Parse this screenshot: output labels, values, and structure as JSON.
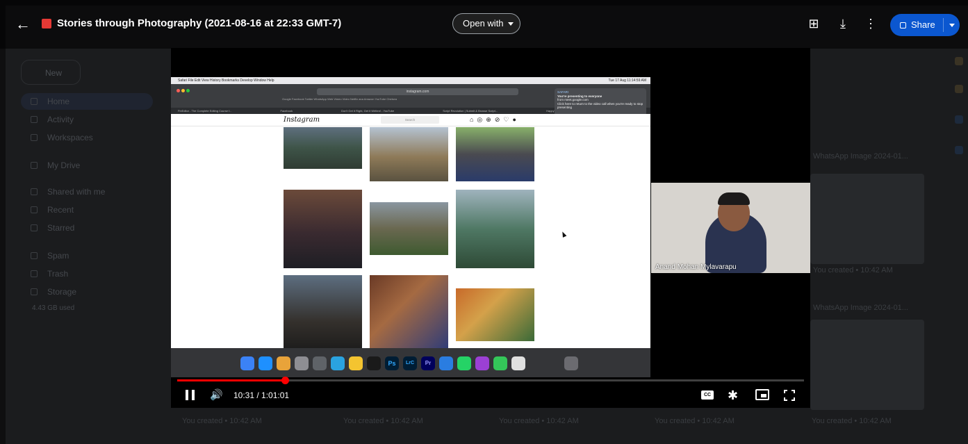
{
  "header": {
    "title": "Stories through Photography (2021-08-16 at 22:33 GMT-7)",
    "open_with_label": "Open with",
    "share_label": "Share"
  },
  "drive_sidebar": {
    "new_label": "New",
    "items": [
      {
        "label": "Home"
      },
      {
        "label": "Activity"
      },
      {
        "label": "Workspaces"
      },
      {
        "label": "My Drive"
      },
      {
        "label": "Shared with me"
      },
      {
        "label": "Recent"
      },
      {
        "label": "Starred"
      },
      {
        "label": "Spam"
      },
      {
        "label": "Trash"
      },
      {
        "label": "Storage"
      }
    ],
    "storage_used": "4.43 GB used"
  },
  "drive_files": {
    "card1_title": "WhatsApp Image 2024-01...",
    "card1_meta": "You created • 10:42 AM",
    "card2_title": "WhatsApp Image 2024-01...",
    "bottom_meta": [
      "You created • 10:42 AM",
      "You created • 10:42 AM",
      "You created • 10:42 AM",
      "You created • 10:42 AM",
      "You created • 10:42 AM"
    ]
  },
  "shared_screen": {
    "menubar": "Safari   File   Edit   View   History   Bookmarks   Develop   Window   Help",
    "clock": "Tue 17 Aug  11:14:59 AM",
    "url": "instagram.com",
    "favorites": "Google   Facebook   Twitter   WhatsApp Web   Vimeo Video   Netflix   ana   Amazon   YouTube   Chelsea",
    "tabs": [
      "FinEditor - The Complete Editing Course f...",
      "Facebook",
      "Don't Get it Right, Get it Written! - YouTube",
      "Script Revolution | Submit & Browse Script...",
      "Happy's Photography (@happys_ph..."
    ],
    "notification_app": "SAFARI",
    "notification_title": "You're presenting to everyone",
    "notification_body": "from meet.google.com",
    "notification_hint": "Click here to return to the video call when you're ready to stop presenting",
    "instagram_logo": "Instagram",
    "search_placeholder": "Search"
  },
  "participant": {
    "name": "Anand Mohan Mylavarapu"
  },
  "player": {
    "current_time": "10:31",
    "duration": "1:01:01",
    "time_display": "10:31 / 1:01:01",
    "progress_fraction": 0.172,
    "cc_label": "CC"
  },
  "colors": {
    "share_blue": "#0b57d0",
    "progress_red": "#ff0000"
  }
}
